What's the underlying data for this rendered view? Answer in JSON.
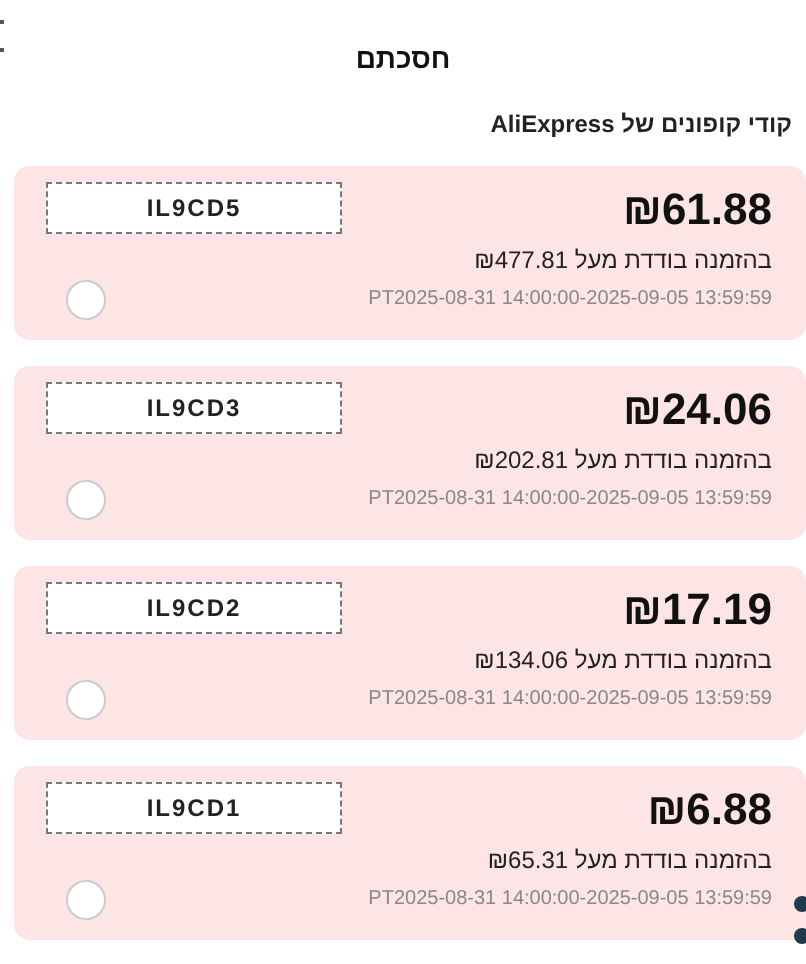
{
  "title": "חסכתם",
  "section_title": "קודי קופונים של AliExpress",
  "coupons": [
    {
      "amount": "₪61.88",
      "condition": "בהזמנה בודדת מעל ₪477.81",
      "validity": "PT2025-08-31 14:00:00-2025-09-05 13:59:59",
      "code": "IL9CD5",
      "selected": false
    },
    {
      "amount": "₪24.06",
      "condition": "בהזמנה בודדת מעל ₪202.81",
      "validity": "PT2025-08-31 14:00:00-2025-09-05 13:59:59",
      "code": "IL9CD3",
      "selected": false
    },
    {
      "amount": "₪17.19",
      "condition": "בהזמנה בודדת מעל ₪134.06",
      "validity": "PT2025-08-31 14:00:00-2025-09-05 13:59:59",
      "code": "IL9CD2",
      "selected": false
    },
    {
      "amount": "₪6.88",
      "condition": "בהזמנה בודדת מעל ₪65.31",
      "validity": "PT2025-08-31 14:00:00-2025-09-05 13:59:59",
      "code": "IL9CD1",
      "selected": false
    }
  ]
}
